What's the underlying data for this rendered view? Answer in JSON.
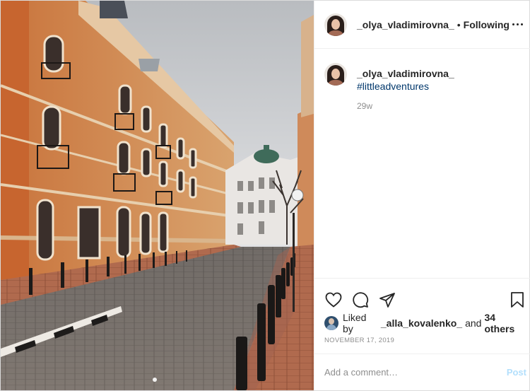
{
  "post": {
    "image_alt": "",
    "carousel_dots": 1
  },
  "header": {
    "username": "_olya_vladimirovna_",
    "separator": "•",
    "follow_status": "Following",
    "more_icon": "more-horizontal-icon"
  },
  "caption": {
    "username": "_olya_vladimirovna_",
    "hashtag": "#littleadventures",
    "time_ago": "29w"
  },
  "actions": {
    "like_icon": "heart-icon",
    "comment_icon": "comment-icon",
    "share_icon": "paper-plane-icon",
    "save_icon": "bookmark-icon"
  },
  "likes": {
    "prefix": "Liked by",
    "user": "_alla_kovalenko_",
    "connector": "and",
    "others": "34 others"
  },
  "date": "NOVEMBER 17, 2019",
  "comment_box": {
    "placeholder": "Add a comment…",
    "post_label": "Post"
  },
  "colors": {
    "link": "#00376b",
    "post_button_disabled": "#b2dffc",
    "muted_text": "#8e8e8e",
    "border": "#dbdbdb"
  }
}
